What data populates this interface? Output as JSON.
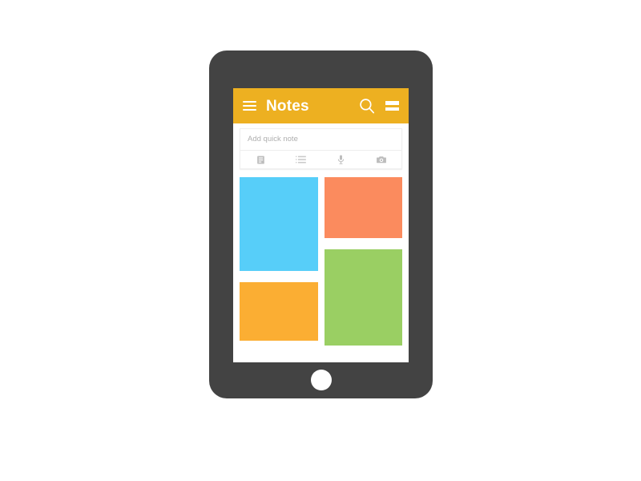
{
  "device": {
    "name": "tablet",
    "frame_color": "#434343",
    "hardware": {
      "front_camera": "front-camera-dot",
      "speaker": "speaker-grille",
      "home_button": "home-button"
    }
  },
  "app": {
    "title": "Notes",
    "bar_color": "#EDB021",
    "bar_text_color": "#FFFFFF",
    "menu_icon": "hamburger-icon",
    "search_icon": "search-icon",
    "overflow_icon": "overflow-menu-icon"
  },
  "quick_note": {
    "placeholder": "Add quick note",
    "value": "",
    "actions": [
      {
        "icon": "text-note-icon",
        "label": "Text note"
      },
      {
        "icon": "checklist-icon",
        "label": "List note"
      },
      {
        "icon": "microphone-icon",
        "label": "Voice note"
      },
      {
        "icon": "camera-icon",
        "label": "Photo note"
      }
    ]
  },
  "notes": {
    "left_column": [
      {
        "id": "note-1",
        "color": "#57CEF9",
        "size": "tall",
        "text": ""
      },
      {
        "id": "note-3",
        "color": "#FBAE33",
        "size": "short",
        "text": ""
      }
    ],
    "right_column": [
      {
        "id": "note-2",
        "color": "#FB8B5E",
        "size": "medium",
        "text": ""
      },
      {
        "id": "note-4",
        "color": "#9ACF63",
        "size": "long",
        "text": ""
      }
    ]
  },
  "palette": {
    "background": "#FFFFFF",
    "frame": "#434343",
    "accent": "#EDB021",
    "blue": "#57CEF9",
    "coral": "#FB8B5E",
    "amber": "#FBAE33",
    "green": "#9ACF63",
    "placeholder_text": "#AFAFAF",
    "icon_gray": "#BDBDBD"
  }
}
